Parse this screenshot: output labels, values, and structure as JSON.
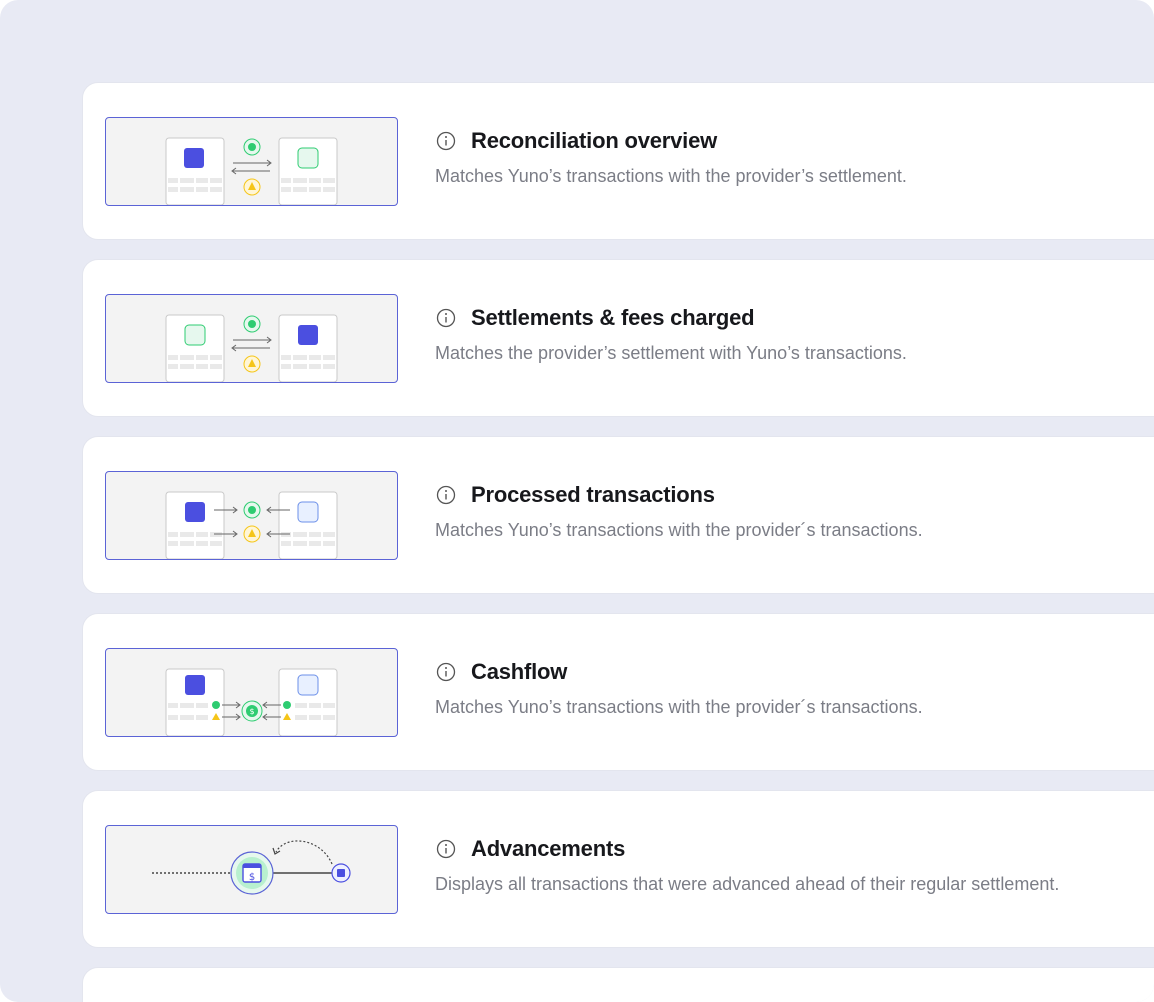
{
  "colors": {
    "background": "#e8eaf4",
    "card": "#ffffff",
    "accent": "#5b63d6",
    "brand_blue": "#4b4fe0",
    "success_green": "#2ecc71",
    "warning_yellow": "#f5c518",
    "title": "#17181c",
    "description": "#7b7d86"
  },
  "cards": [
    {
      "title": "Reconciliation overview",
      "description": "Matches Yuno’s transactions with the provider’s settlement.",
      "icon": "info-icon"
    },
    {
      "title": "Settlements & fees charged",
      "description": "Matches the provider’s settlement with Yuno’s transactions.",
      "icon": "info-icon"
    },
    {
      "title": "Processed transactions",
      "description": "Matches Yuno’s transactions with the provider´s transactions.",
      "icon": "info-icon"
    },
    {
      "title": "Cashflow",
      "description": "Matches Yuno’s transactions with the provider´s transactions.",
      "icon": "info-icon"
    },
    {
      "title": "Advancements",
      "description": "Displays all transactions that were advanced ahead of their regular settlement.",
      "icon": "info-icon"
    }
  ]
}
